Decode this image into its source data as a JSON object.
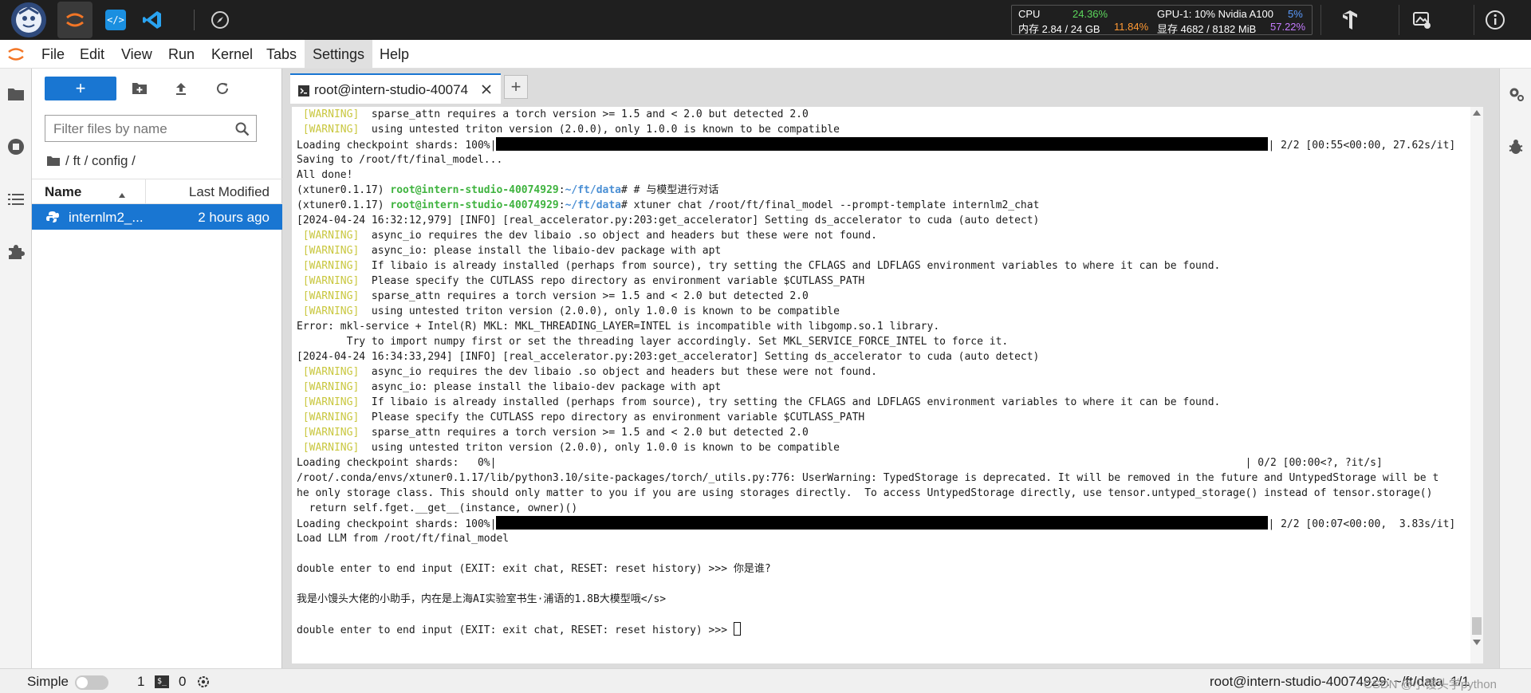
{
  "resource": {
    "cpu_label": "CPU",
    "cpu_value": "24.36%",
    "mem_label": "内存 2.84 / 24 GB",
    "mem_value": "11.84%",
    "gpu_label": "GPU-1: 10% Nvidia A100",
    "gpu_value": "5%",
    "vram_label": "显存 4682 / 8182 MiB",
    "vram_value": "57.22%"
  },
  "menu": [
    "File",
    "Edit",
    "View",
    "Run",
    "Kernel",
    "Tabs",
    "Settings",
    "Help"
  ],
  "menu_active": "Settings",
  "filebrowser": {
    "new_button": "+",
    "filter_placeholder": "Filter files by name",
    "breadcrumb": "/ ft / config /",
    "col_name": "Name",
    "col_modified": "Last Modified",
    "file_name": "internlm2_...",
    "file_modified": "2 hours ago"
  },
  "tab": {
    "label": "root@intern-studio-40074",
    "add": "+"
  },
  "terminal": {
    "warning_tag": "[WARNING]",
    "prompt_env": "(xtuner0.1.17)",
    "prompt_host": "root@intern-studio-40074929",
    "prompt_path": "~/ft/data",
    "lines": [
      {
        "t": "warn",
        "msg": "sparse_attn requires a torch version >= 1.5 and < 2.0 but detected 2.0"
      },
      {
        "t": "warn",
        "msg": "using untested triton version (2.0.0), only 1.0.0 is known to be compatible"
      },
      {
        "t": "bar",
        "pre": "Loading checkpoint shards: 100%|",
        "post": "| 2/2 [00:55<00:00, 27.62s/it]"
      },
      {
        "t": "text",
        "msg": "Saving to /root/ft/final_model..."
      },
      {
        "t": "text",
        "msg": "All done!"
      },
      {
        "t": "prompt",
        "cmd": "# # 与模型进行对话"
      },
      {
        "t": "prompt",
        "cmd": "# xtuner chat /root/ft/final_model --prompt-template internlm2_chat"
      },
      {
        "t": "text",
        "msg": "[2024-04-24 16:32:12,979] [INFO] [real_accelerator.py:203:get_accelerator] Setting ds_accelerator to cuda (auto detect)"
      },
      {
        "t": "warn",
        "msg": "async_io requires the dev libaio .so object and headers but these were not found."
      },
      {
        "t": "warn",
        "msg": "async_io: please install the libaio-dev package with apt"
      },
      {
        "t": "warn",
        "msg": "If libaio is already installed (perhaps from source), try setting the CFLAGS and LDFLAGS environment variables to where it can be found."
      },
      {
        "t": "warn",
        "msg": "Please specify the CUTLASS repo directory as environment variable $CUTLASS_PATH"
      },
      {
        "t": "warn",
        "msg": "sparse_attn requires a torch version >= 1.5 and < 2.0 but detected 2.0"
      },
      {
        "t": "warn",
        "msg": "using untested triton version (2.0.0), only 1.0.0 is known to be compatible"
      },
      {
        "t": "text",
        "msg": "Error: mkl-service + Intel(R) MKL: MKL_THREADING_LAYER=INTEL is incompatible with libgomp.so.1 library."
      },
      {
        "t": "text",
        "msg": "        Try to import numpy first or set the threading layer accordingly. Set MKL_SERVICE_FORCE_INTEL to force it."
      },
      {
        "t": "text",
        "msg": "[2024-04-24 16:34:33,294] [INFO] [real_accelerator.py:203:get_accelerator] Setting ds_accelerator to cuda (auto detect)"
      },
      {
        "t": "warn",
        "msg": "async_io requires the dev libaio .so object and headers but these were not found."
      },
      {
        "t": "warn",
        "msg": "async_io: please install the libaio-dev package with apt"
      },
      {
        "t": "warn",
        "msg": "If libaio is already installed (perhaps from source), try setting the CFLAGS and LDFLAGS environment variables to where it can be found."
      },
      {
        "t": "warn",
        "msg": "Please specify the CUTLASS repo directory as environment variable $CUTLASS_PATH"
      },
      {
        "t": "warn",
        "msg": "sparse_attn requires a torch version >= 1.5 and < 2.0 but detected 2.0"
      },
      {
        "t": "warn",
        "msg": "using untested triton version (2.0.0), only 1.0.0 is known to be compatible"
      },
      {
        "t": "text",
        "msg": "Loading checkpoint shards:   0%|                                                                                                                        | 0/2 [00:00<?, ?it/s]"
      },
      {
        "t": "text",
        "msg": "/root/.conda/envs/xtuner0.1.17/lib/python3.10/site-packages/torch/_utils.py:776: UserWarning: TypedStorage is deprecated. It will be removed in the future and UntypedStorage will be t"
      },
      {
        "t": "text",
        "msg": "he only storage class. This should only matter to you if you are using storages directly.  To access UntypedStorage directly, use tensor.untyped_storage() instead of tensor.storage()"
      },
      {
        "t": "text",
        "msg": "  return self.fget.__get__(instance, owner)()"
      },
      {
        "t": "bar",
        "pre": "Loading checkpoint shards: 100%|",
        "post": "| 2/2 [00:07<00:00,  3.83s/it]"
      },
      {
        "t": "text",
        "msg": "Load LLM from /root/ft/final_model"
      },
      {
        "t": "text",
        "msg": ""
      },
      {
        "t": "text",
        "msg": "double enter to end input (EXIT: exit chat, RESET: reset history) >>> 你是谁?"
      },
      {
        "t": "text",
        "msg": ""
      },
      {
        "t": "text",
        "msg": "我是小馒头大佬的小助手，内在是上海AI实验室书生·浦语的1.8B大模型哦</s>"
      },
      {
        "t": "text",
        "msg": ""
      },
      {
        "t": "cursor",
        "msg": "double enter to end input (EXIT: exit chat, RESET: reset history) >>> "
      }
    ]
  },
  "status": {
    "mode_label": "Simple",
    "kernels": "1",
    "terminals": "0",
    "path": "root@intern-studio-40074929: ~/ft/data",
    "page": "1/1",
    "watermark": "CSDN @小馒头学python"
  }
}
